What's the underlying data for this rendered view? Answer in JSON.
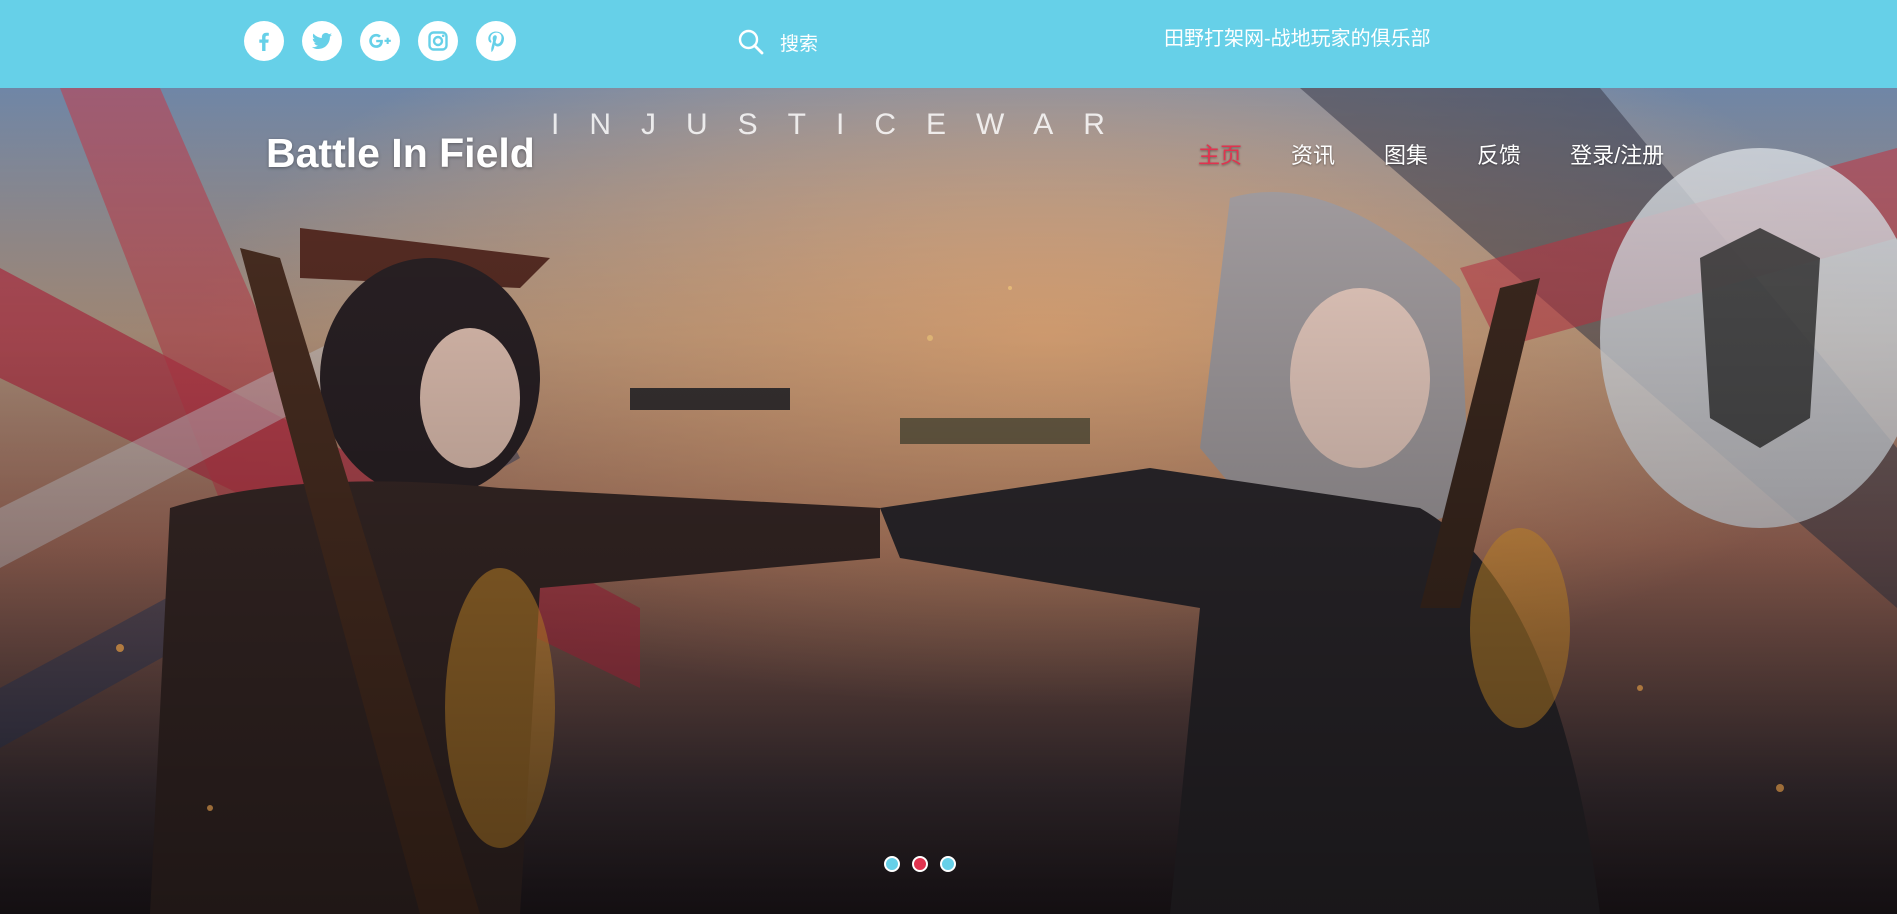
{
  "header": {
    "social": [
      {
        "name": "facebook-icon",
        "glyph": "f"
      },
      {
        "name": "twitter-icon",
        "glyph": "t"
      },
      {
        "name": "google-plus-icon",
        "glyph": "g+"
      },
      {
        "name": "instagram-icon",
        "glyph": "ig"
      },
      {
        "name": "pinterest-icon",
        "glyph": "p"
      }
    ],
    "search_label": "搜索",
    "tagline": "田野打架网-战地玩家的俱乐部"
  },
  "hero": {
    "logo": "Battle In Field",
    "banner_text": "INJUSTICEWAR",
    "nav": [
      "主页",
      "资讯",
      "图集",
      "反馈",
      "登录/注册"
    ],
    "active_nav_index": 0,
    "carousel": {
      "total": 3,
      "active_index": 1
    }
  },
  "colors": {
    "topbar": "#66d0e8",
    "accent": "#e0334f",
    "text": "#ffffff"
  }
}
